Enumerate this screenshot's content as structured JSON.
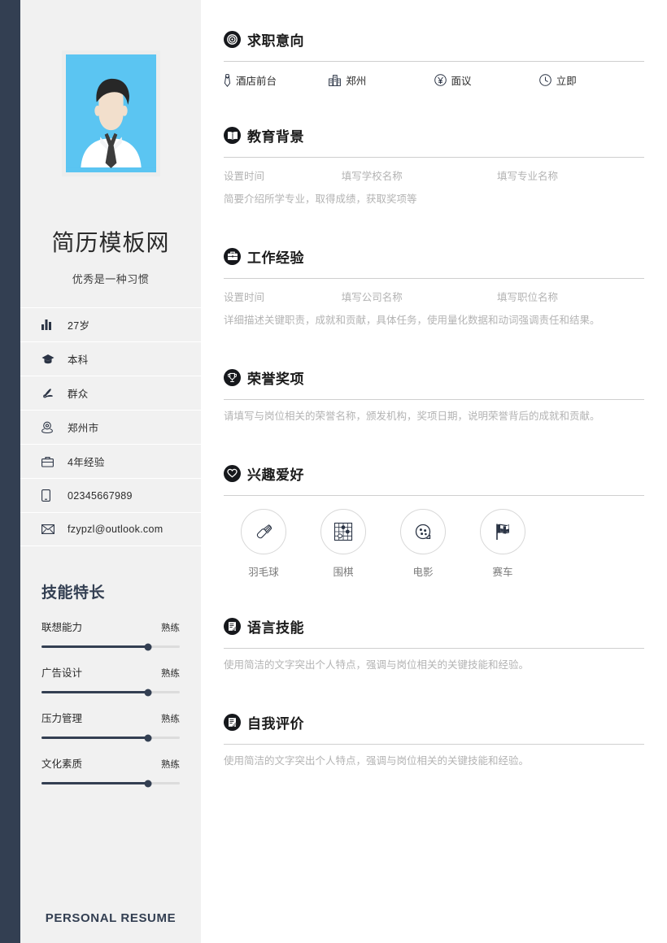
{
  "theme": {
    "navy": "#333f52",
    "sidebar_bg": "#f1f1f1",
    "badge_bg": "#16181c",
    "placeholder_text": "#b3b3b3",
    "photo_bg": "#5bc5f2"
  },
  "sidebar": {
    "full_name": "简历模板网",
    "slogan": "优秀是一种习惯",
    "info_items": [
      {
        "icon": "bar-chart-icon",
        "label": "27岁"
      },
      {
        "icon": "graduation-cap-icon",
        "label": "本科"
      },
      {
        "icon": "party-emblem-icon",
        "label": "群众"
      },
      {
        "icon": "location-pin-icon",
        "label": "郑州市"
      },
      {
        "icon": "briefcase-icon",
        "label": "4年经验"
      },
      {
        "icon": "mobile-phone-icon",
        "label": "02345667989"
      },
      {
        "icon": "envelope-icon",
        "label": "fzypzl@outlook.com"
      }
    ],
    "skills_title": "技能特长",
    "skills": [
      {
        "name": "联想能力",
        "level": "熟练",
        "percent": 77
      },
      {
        "name": "广告设计",
        "level": "熟练",
        "percent": 77
      },
      {
        "name": "压力管理",
        "level": "熟练",
        "percent": 77
      },
      {
        "name": "文化素质",
        "level": "熟练",
        "percent": 77
      }
    ],
    "footer_label": "PERSONAL RESUME"
  },
  "main": {
    "job_intent": {
      "icon": "target-icon",
      "title": "求职意向",
      "items": [
        {
          "icon": "necktie-icon",
          "text": "酒店前台"
        },
        {
          "icon": "building-icon",
          "text": "郑州"
        },
        {
          "icon": "yen-coin-icon",
          "text": "面议"
        },
        {
          "icon": "clock-icon",
          "text": "立即"
        }
      ]
    },
    "education": {
      "icon": "open-book-icon",
      "title": "教育背景",
      "meta": [
        "设置时间",
        "填写学校名称",
        "填写专业名称"
      ],
      "body": "简要介绍所学专业，取得成绩，获取奖项等"
    },
    "work": {
      "icon": "briefcase-icon",
      "title": "工作经验",
      "meta": [
        "设置时间",
        "填写公司名称",
        "填写职位名称"
      ],
      "body": "详细描述关键职责，成就和贡献，具体任务，使用量化数据和动词强调责任和结果。"
    },
    "honors": {
      "icon": "trophy-icon",
      "title": "荣誉奖项",
      "body": "请填写与岗位相关的荣誉名称，颁发机构，奖项日期，说明荣誉背后的成就和贡献。"
    },
    "hobbies": {
      "icon": "heart-icon",
      "title": "兴趣爱好",
      "items": [
        {
          "icon": "shuttlecock-icon",
          "name": "羽毛球"
        },
        {
          "icon": "go-board-icon",
          "name": "围棋"
        },
        {
          "icon": "film-reel-icon",
          "name": "电影"
        },
        {
          "icon": "checkered-flag-icon",
          "name": "赛车"
        }
      ]
    },
    "language": {
      "icon": "note-pad-icon",
      "title": "语言技能",
      "body": "使用简洁的文字突出个人特点，强调与岗位相关的关键技能和经验。"
    },
    "self_eval": {
      "icon": "note-pad-icon",
      "title": "自我评价",
      "body": "使用简洁的文字突出个人特点，强调与岗位相关的关键技能和经验。"
    }
  }
}
